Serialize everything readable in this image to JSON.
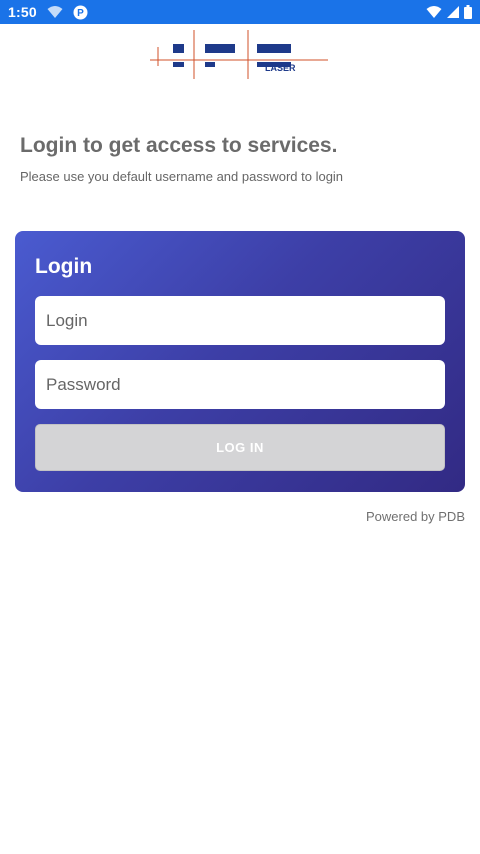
{
  "status_bar": {
    "time": "1:50",
    "color": "#1a73e8",
    "left_icons": [
      "wifi-icon",
      "app-notification-icon"
    ],
    "right_icons": [
      "wifi-icon",
      "cellular-signal-icon",
      "battery-icon"
    ]
  },
  "logo": {
    "main": "I P G",
    "sub": "LASER",
    "colors": {
      "text": "#1e3a8a",
      "lines": "#d0502a"
    }
  },
  "intro": {
    "heading": "Login to get access to services.",
    "subheading": "Please use you default username and password to login"
  },
  "login_card": {
    "title": "Login",
    "login_placeholder": "Login",
    "password_placeholder": "Password",
    "button_label": "LOG IN",
    "gradient": [
      "#4a5bd0",
      "#322a84"
    ]
  },
  "footer": {
    "powered_by": "Powered by PDB"
  }
}
